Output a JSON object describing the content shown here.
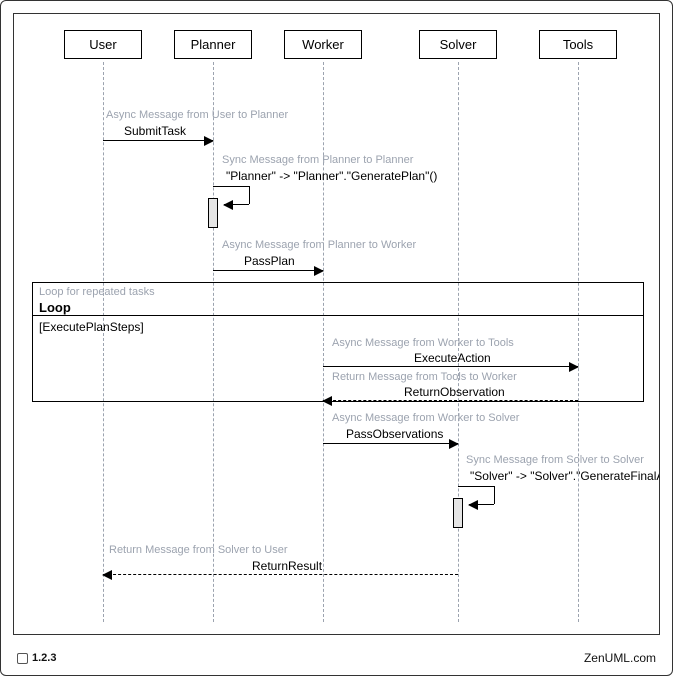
{
  "actors": {
    "user": "User",
    "planner": "Planner",
    "worker": "Worker",
    "solver": "Solver",
    "tools": "Tools"
  },
  "annotations": {
    "a1": "Async Message from User to Planner",
    "a2": "Sync Message from Planner to Planner",
    "a3": "Async Message from Planner to Worker",
    "a4": "Async Message from Worker to Tools",
    "a5": "Return Message from Tools to Worker",
    "a6": "Async Message from Worker to Solver",
    "a7": "Sync Message from Solver to Solver",
    "a8": "Return Message from Solver to User"
  },
  "messages": {
    "m1": "SubmitTask",
    "m2": "\"Planner\" -> \"Planner\".\"GeneratePlan\"()",
    "m3": "PassPlan",
    "m4": "ExecuteAction",
    "m5": "ReturnObservation",
    "m6": "PassObservations",
    "m7": "\"Solver\" -> \"Solver\".\"GenerateFinalAn",
    "m8": "ReturnResult"
  },
  "loop": {
    "title": "Loop for repeated tasks",
    "label": "Loop",
    "condition": "[ExecutePlanSteps]"
  },
  "footer": {
    "version": "1.2.3",
    "credit": "ZenUML.com"
  }
}
